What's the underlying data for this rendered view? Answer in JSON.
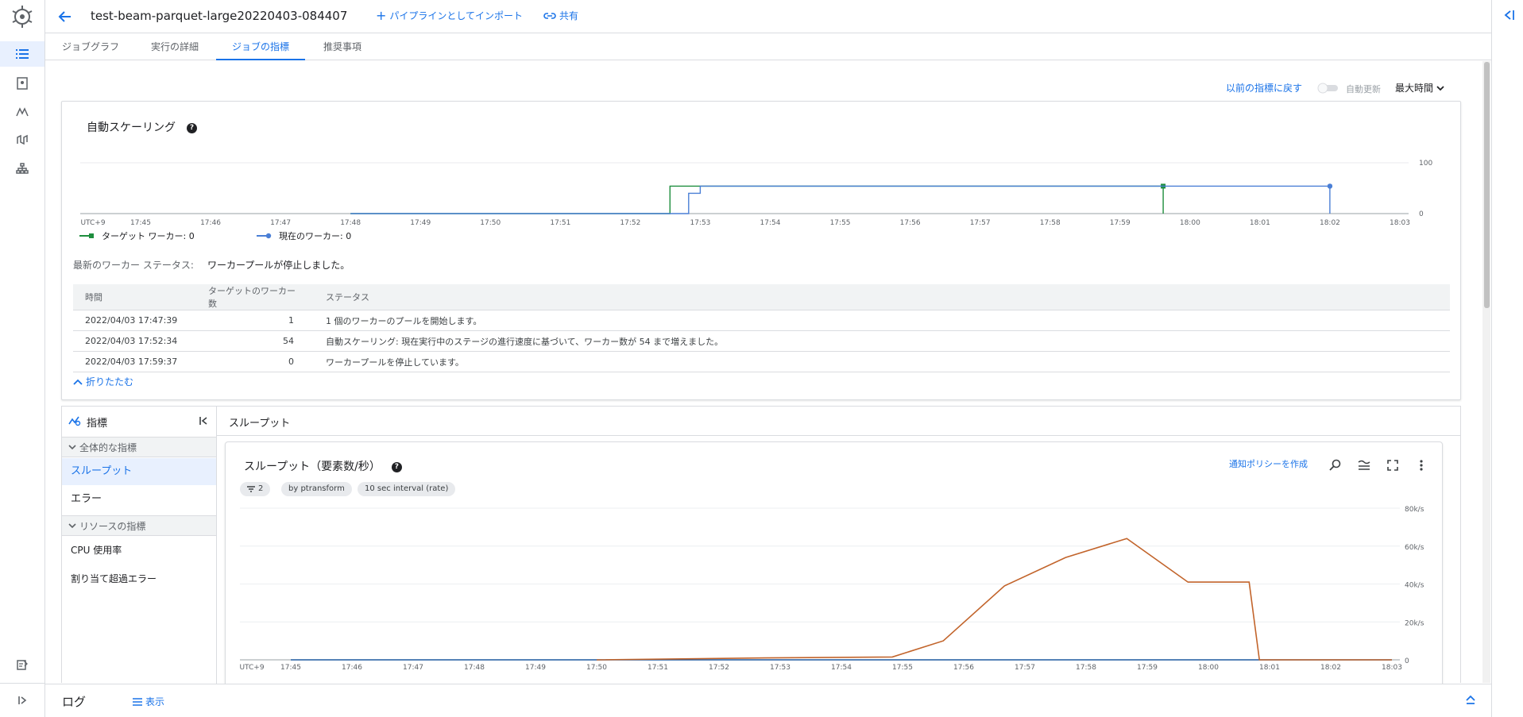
{
  "header": {
    "job_title": "test-beam-parquet-large20220403-084407",
    "import_label": "パイプラインとしてインポート",
    "share_label": "共有"
  },
  "tabs": [
    {
      "label": "ジョブグラフ"
    },
    {
      "label": "実行の詳細"
    },
    {
      "label": "ジョブの指標"
    },
    {
      "label": "推奨事項"
    }
  ],
  "controls": {
    "revert_label": "以前の指標に戻す",
    "auto_refresh_label": "自動更新",
    "time_range_label": "最大時間"
  },
  "autoscaling": {
    "title": "自動スケーリング",
    "help": "?",
    "status_label": "最新のワーカー ステータス:",
    "status_value": "ワーカープールが停止しました。",
    "legend": [
      {
        "label": "ターゲット ワーカー: 0",
        "color": "#1e8e3e"
      },
      {
        "label": "現在のワーカー: 0",
        "color": "#4a7fd6"
      }
    ],
    "table": {
      "headers": [
        "時間",
        "ターゲットのワーカー数",
        "ステータス"
      ],
      "rows": [
        [
          "2022/04/03 17:47:39",
          "1",
          "1 個のワーカーのプールを開始します。"
        ],
        [
          "2022/04/03 17:52:34",
          "54",
          "自動スケーリング: 現在実行中のステージの進行速度に基づいて、ワーカー数が 54 まで増えました。"
        ],
        [
          "2022/04/03 17:59:37",
          "0",
          "ワーカープールを停止しています。"
        ]
      ]
    },
    "fold_label": "折りたたむ"
  },
  "metrics_nav": {
    "title": "指標",
    "groups": [
      {
        "label": "全体的な指標",
        "items": [
          "スループット",
          "エラー"
        ]
      },
      {
        "label": "リソースの指標",
        "items": [
          "CPU 使用率",
          "割り当て超過エラー"
        ]
      }
    ]
  },
  "throughput": {
    "panel_title": "スループット",
    "chart_title": "スループット（要素数/秒）",
    "chips": [
      "2",
      "by ptransform",
      "10 sec interval (rate)"
    ],
    "alert_link": "通知ポリシーを作成"
  },
  "footer": {
    "log_label": "ログ",
    "show_label": "表示"
  },
  "chart_data": [
    {
      "type": "line",
      "x_tick_labels": [
        "UTC+9",
        "17:45",
        "17:46",
        "17:47",
        "17:48",
        "17:49",
        "17:50",
        "17:51",
        "17:52",
        "17:53",
        "17:54",
        "17:55",
        "17:56",
        "17:57",
        "17:58",
        "17:59",
        "18:00",
        "18:01",
        "18:02",
        "18:03"
      ],
      "y_ticks": [
        "100",
        "0"
      ],
      "ylim": [
        0,
        100
      ],
      "series": [
        {
          "name": "ターゲット ワーカー: 0",
          "color": "#1e8e3e",
          "points": [
            [
              "17:48",
              0
            ],
            [
              "17:52:34",
              0
            ],
            [
              "17:52:34",
              54
            ],
            [
              "17:59:37",
              54
            ],
            [
              "17:59:37",
              0
            ]
          ]
        },
        {
          "name": "現在のワーカー: 0",
          "color": "#4a7fd6",
          "points": [
            [
              "17:48",
              0
            ],
            [
              "17:52:50",
              0
            ],
            [
              "17:52:50",
              40
            ],
            [
              "17:53",
              40
            ],
            [
              "17:53",
              54
            ],
            [
              "18:02",
              54
            ],
            [
              "18:02",
              0
            ]
          ]
        }
      ]
    },
    {
      "type": "line",
      "x_tick_labels": [
        "UTC+9",
        "17:45",
        "17:46",
        "17:47",
        "17:48",
        "17:49",
        "17:50",
        "17:51",
        "17:52",
        "17:53",
        "17:54",
        "17:55",
        "17:56",
        "17:57",
        "17:58",
        "17:59",
        "18:00",
        "18:01",
        "18:02",
        "18:03"
      ],
      "y_ticks": [
        "80k/s",
        "60k/s",
        "40k/s",
        "20k/s",
        "0"
      ],
      "ylim": [
        0,
        80000
      ],
      "series": [
        {
          "color": "#c2642b",
          "points": [
            [
              "17:50",
              0
            ],
            [
              "17:52:45",
              1000
            ],
            [
              "17:54:50",
              1500
            ],
            [
              "17:55:40",
              10000
            ],
            [
              "17:56:40",
              39000
            ],
            [
              "17:57:40",
              54000
            ],
            [
              "17:58:40",
              64000
            ],
            [
              "17:59:40",
              41000
            ],
            [
              "18:00:40",
              41000
            ],
            [
              "18:00:50",
              0
            ],
            [
              "18:03",
              0
            ]
          ]
        },
        {
          "color": "#1e5aa0",
          "points": [
            [
              "17:45",
              0
            ],
            [
              "18:03",
              0
            ]
          ]
        }
      ]
    }
  ]
}
